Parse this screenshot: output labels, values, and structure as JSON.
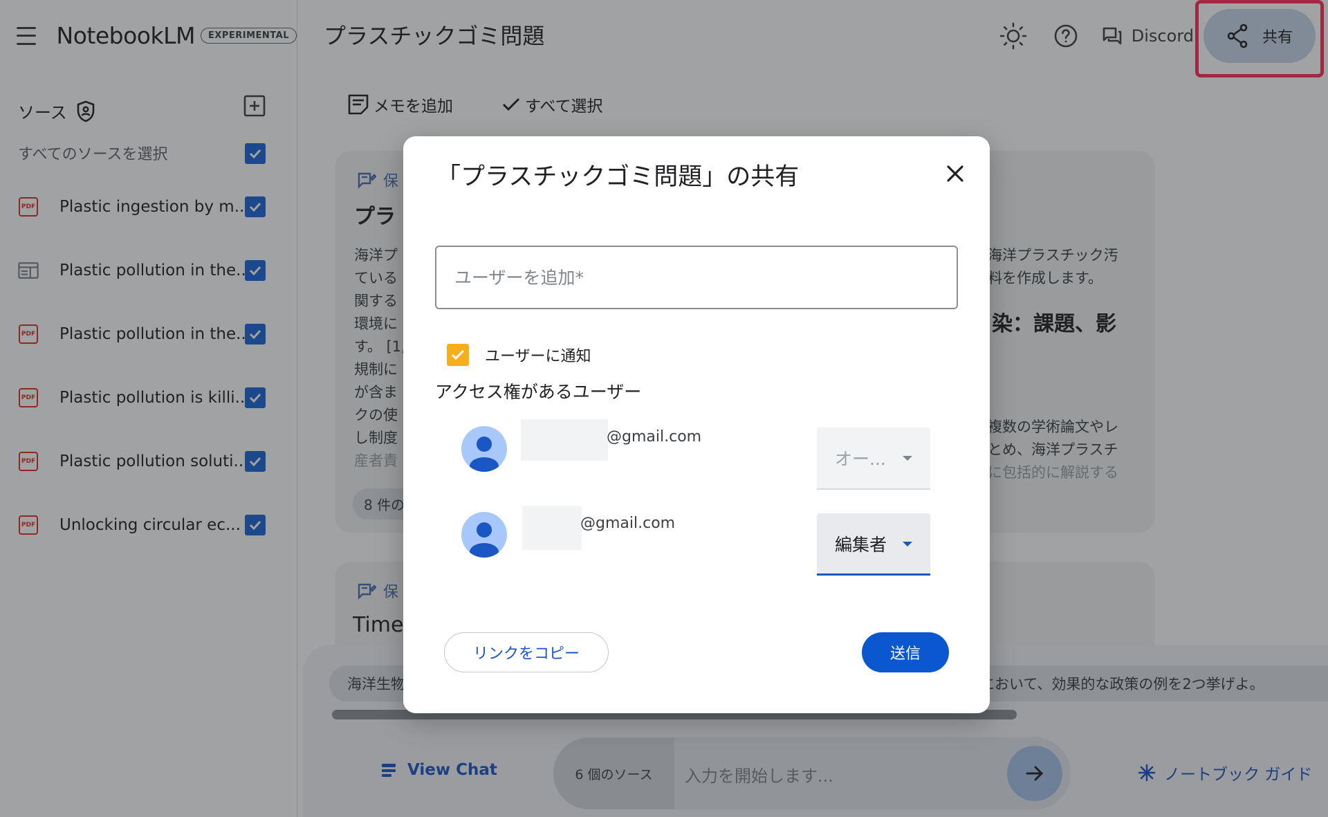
{
  "app": {
    "name": "NotebookLM",
    "badge": "EXPERIMENTAL",
    "notebook_title": "プラスチックゴミ問題"
  },
  "top_actions": {
    "discord_label": "Discord",
    "share_label": "共有"
  },
  "sidebar": {
    "sources_heading": "ソース",
    "select_all_label": "すべてのソースを選択",
    "items": [
      {
        "label": "Plastic ingestion by m...",
        "icon": "pdf-icon"
      },
      {
        "label": "Plastic pollution in the...",
        "icon": "web-page-icon"
      },
      {
        "label": "Plastic pollution in the...",
        "icon": "pdf-icon"
      },
      {
        "label": "Plastic pollution is killi...",
        "icon": "pdf-icon"
      },
      {
        "label": "Plastic pollution soluti...",
        "icon": "pdf-icon"
      },
      {
        "label": "Unlocking circular ec...",
        "icon": "pdf-icon"
      }
    ]
  },
  "main": {
    "toolbar": {
      "add_note": "メモを追加",
      "select_all": "すべて選択"
    },
    "card1": {
      "tag": "保",
      "title_left": "プラ",
      "title_right": "染：課題、影",
      "text_left": [
        "海洋プ",
        "ている",
        "関する",
        "環境に",
        "す。 [1,",
        "規制に",
        "が含ま",
        "クの使",
        "し制度",
        "産者責"
      ],
      "text_right_top": [
        "海洋プラスチック汚",
        "料を作成します。"
      ],
      "text_right_bottom": [
        "複数の学術論文やレ",
        "とめ、海洋プラスチ",
        "に包括的に解説する"
      ],
      "pill": "8 件の"
    },
    "card2": {
      "tag": "保",
      "title_left": "Timel"
    },
    "suggestions": {
      "left": "海洋生物",
      "right": "題において、効果的な政策の例を2つ挙げよ。"
    },
    "chat": {
      "view_chat": "View Chat",
      "source_count": "6 個のソース",
      "input_placeholder": "入力を開始します...",
      "notebook_guide": "ノートブック ガイド"
    }
  },
  "dialog": {
    "title": "「プラスチックゴミ問題」の共有",
    "add_user_placeholder": "ユーザーを追加*",
    "add_user_value": "",
    "notify_label": "ユーザーに通知",
    "access_heading": "アクセス権があるユーザー",
    "users": [
      {
        "email_suffix": "@gmail.com",
        "role": "オー..."
      },
      {
        "email_suffix": "@gmail.com",
        "role": "編集者"
      }
    ],
    "copy_link": "リンクをコピー",
    "send": "送信"
  },
  "colors": {
    "accent": "#0b57d0",
    "checkbox_blue": "#1a66d6",
    "notify_checkbox": "#f6ae1a",
    "highlight": "#ff2d55"
  }
}
